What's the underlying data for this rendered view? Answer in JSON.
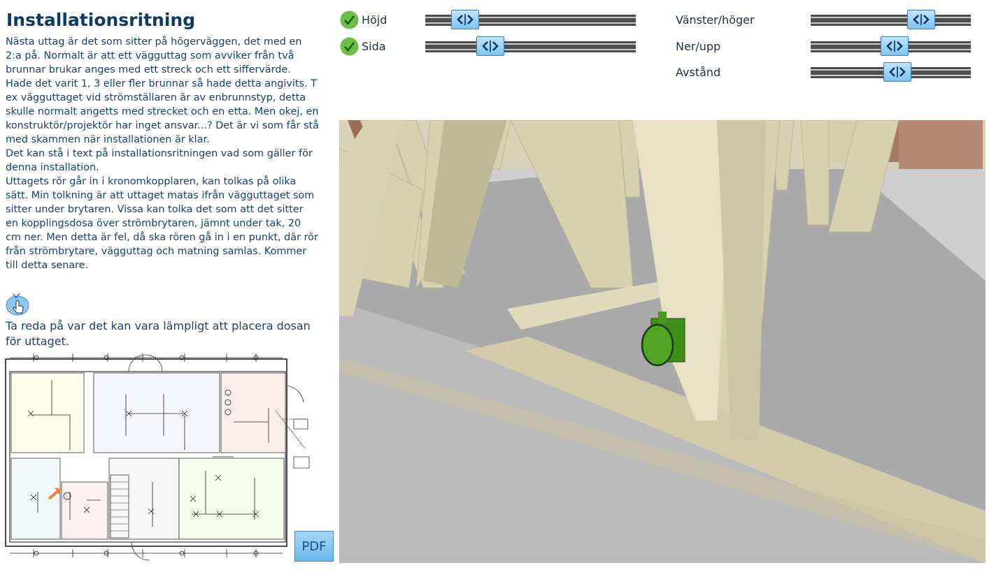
{
  "page": {
    "title": "Installationsritning",
    "paragraphs": [
      "Nästa uttag är det som sitter på högerväggen, det med en 2:a på. Normalt är att ett vägguttag som avviker från två brunnar brukar anges med ett streck och ett siffervärde. Hade det varit 1, 3 eller fler brunnar så hade detta angivits. T ex vägguttaget vid strömställaren är av enbrunnstyp, detta skulle normalt angetts med strecket och en etta. Men okej, en konstruktör/projektör har inget ansvar...? Det är vi som får stå med skammen när installationen är klar.",
      "Det kan stå i text på installationsritningen vad som gäller för denna installation.",
      "Uttagets rör går in i kronomkopplaren, kan tolkas på olika sätt. Min tolkning är att uttaget matas ifrån vägguttaget som sitter under brytaren. Vissa kan tolka det som att det sitter en kopplingsdosa över strömbrytaren, jämnt under tak, 20 cm ner. Men detta är fel, då ska rören gå in i en punkt, där rör från strömbrytare, vägguttag och matning samlas. Kommer till detta senare."
    ],
    "task": "Ta reda på var det kan vara lämpligt att placera dosan för uttaget.",
    "pdf_label": "PDF"
  },
  "controls": {
    "left": [
      {
        "label": "Höjd",
        "checked": true,
        "value": 0.14
      },
      {
        "label": "Sida",
        "checked": true,
        "value": 0.28
      }
    ],
    "right": [
      {
        "label": "Vänster/höger",
        "value": 0.73
      },
      {
        "label": "Ner/upp",
        "value": 0.53
      },
      {
        "label": "Avstånd",
        "value": 0.55
      }
    ]
  },
  "icons": {
    "check": "check-circle-icon",
    "hand": "pointer-hand-icon",
    "slider": "left-right-arrows-icon"
  },
  "colors": {
    "title": "#0f3a66",
    "text": "#17407a",
    "button": "#7ec3f2",
    "check": "#6cc04a",
    "socket": "#3f9a1e",
    "floor": "#a8a8a8",
    "wood": "#d7d0b0"
  }
}
